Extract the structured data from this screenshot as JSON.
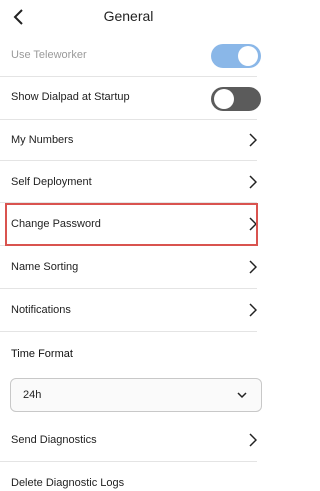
{
  "header": {
    "title": "General"
  },
  "rows": {
    "use_teleworker": {
      "label": "Use Teleworker",
      "toggle": "on"
    },
    "show_dialpad": {
      "label": "Show Dialpad at Startup",
      "toggle": "off"
    },
    "my_numbers": {
      "label": "My Numbers"
    },
    "self_deployment": {
      "label": "Self Deployment"
    },
    "change_password": {
      "label": "Change Password"
    },
    "name_sorting": {
      "label": "Name Sorting"
    },
    "notifications": {
      "label": "Notifications"
    },
    "send_diagnostics": {
      "label": "Send Diagnostics"
    },
    "delete_logs": {
      "label": "Delete Diagnostic Logs"
    }
  },
  "time_format": {
    "label": "Time Format",
    "selected": "24h"
  },
  "colors": {
    "toggle_on": "#8ab7e8",
    "toggle_off": "#5b5b5b",
    "highlight": "#d9534f"
  }
}
